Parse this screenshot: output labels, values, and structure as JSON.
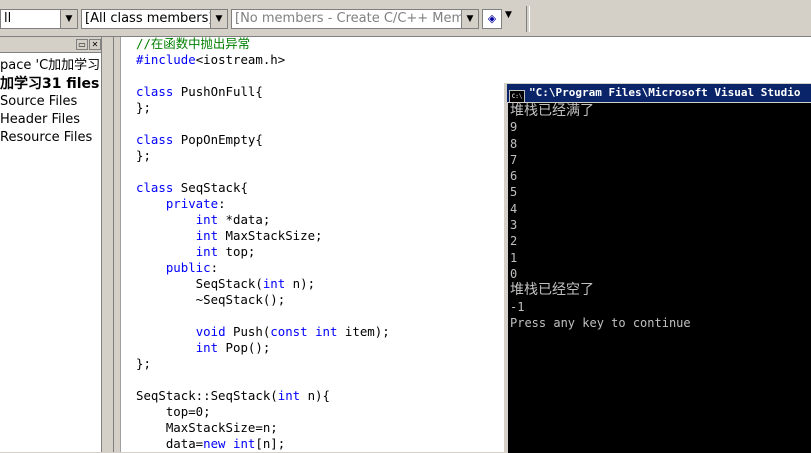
{
  "toolbar": {
    "scope_combo": "ll",
    "class_combo": "[All class members]",
    "members_combo": "[No members - Create C/C++ Member]"
  },
  "workspace": {
    "items": [
      {
        "label": "pace 'C加加学习",
        "bold": false
      },
      {
        "label": "加学习31 files",
        "bold": true
      },
      {
        "label": "Source Files",
        "bold": false
      },
      {
        "label": "Header Files",
        "bold": false
      },
      {
        "label": "Resource Files",
        "bold": false
      }
    ]
  },
  "editor": {
    "lines": [
      [
        [
          "cm",
          "//在函数中抛出异常"
        ]
      ],
      [
        [
          "kw",
          "#include"
        ],
        [
          "",
          "<iostream.h>"
        ]
      ],
      [
        [
          "",
          ""
        ]
      ],
      [
        [
          "kw",
          "class"
        ],
        [
          "",
          " PushOnFull{"
        ]
      ],
      [
        [
          "",
          "};"
        ]
      ],
      [
        [
          "",
          ""
        ]
      ],
      [
        [
          "kw",
          "class"
        ],
        [
          "",
          " PopOnEmpty{"
        ]
      ],
      [
        [
          "",
          "};"
        ]
      ],
      [
        [
          "",
          ""
        ]
      ],
      [
        [
          "kw",
          "class"
        ],
        [
          "",
          " SeqStack{"
        ]
      ],
      [
        [
          "",
          "    "
        ],
        [
          "kw",
          "private"
        ],
        [
          "",
          ":"
        ]
      ],
      [
        [
          "",
          "        "
        ],
        [
          "kw",
          "int"
        ],
        [
          "",
          " *data;"
        ]
      ],
      [
        [
          "",
          "        "
        ],
        [
          "kw",
          "int"
        ],
        [
          "",
          " MaxStackSize;"
        ]
      ],
      [
        [
          "",
          "        "
        ],
        [
          "kw",
          "int"
        ],
        [
          "",
          " top;"
        ]
      ],
      [
        [
          "",
          "    "
        ],
        [
          "kw",
          "public"
        ],
        [
          "",
          ":"
        ]
      ],
      [
        [
          "",
          "        SeqStack("
        ],
        [
          "kw",
          "int"
        ],
        [
          "",
          " n);"
        ]
      ],
      [
        [
          "",
          "        ~SeqStack();"
        ]
      ],
      [
        [
          "",
          ""
        ]
      ],
      [
        [
          "",
          "        "
        ],
        [
          "kw",
          "void"
        ],
        [
          "",
          " Push("
        ],
        [
          "kw",
          "const"
        ],
        [
          "",
          " "
        ],
        [
          "kw",
          "int"
        ],
        [
          "",
          " item);"
        ]
      ],
      [
        [
          "",
          "        "
        ],
        [
          "kw",
          "int"
        ],
        [
          "",
          " Pop();"
        ]
      ],
      [
        [
          "",
          "};"
        ]
      ],
      [
        [
          "",
          ""
        ]
      ],
      [
        [
          "",
          "SeqStack::SeqStack("
        ],
        [
          "kw",
          "int"
        ],
        [
          "",
          " n){"
        ]
      ],
      [
        [
          "",
          "    top=0;"
        ]
      ],
      [
        [
          "",
          "    MaxStackSize=n;"
        ]
      ],
      [
        [
          "",
          "    data="
        ],
        [
          "kw",
          "new"
        ],
        [
          "",
          " "
        ],
        [
          "kw",
          "int"
        ],
        [
          "",
          "[n];"
        ]
      ]
    ]
  },
  "console": {
    "title": "\"C:\\Program Files\\Microsoft Visual Studio",
    "lines": [
      "堆栈已经满了",
      "9",
      "8",
      "7",
      "6",
      "5",
      "4",
      "3",
      "2",
      "1",
      "0",
      "堆栈已经空了",
      "-1",
      "Press any key to continue"
    ]
  }
}
